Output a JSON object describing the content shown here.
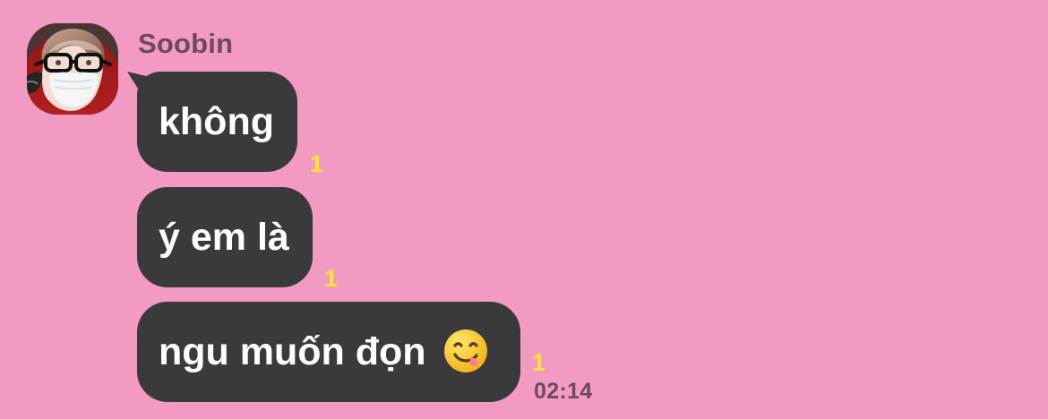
{
  "conversation": {
    "sender_name": "Soobin",
    "avatar": {
      "type": "profile-photo",
      "icon": "person-with-glasses-and-mask-icon"
    },
    "messages": [
      {
        "text": "không",
        "read_count": "1"
      },
      {
        "text": "ý em là",
        "read_count": "1"
      },
      {
        "text": "ngu muốn đọn",
        "emoji": "😋",
        "read_count": "1",
        "timestamp": "02:14"
      }
    ]
  },
  "colors": {
    "background": "#f39ac3",
    "bubble": "#3a3a3c",
    "bubble_text": "#ffffff",
    "read_count": "#ffe62e",
    "name_and_time": "#6d4a61"
  }
}
